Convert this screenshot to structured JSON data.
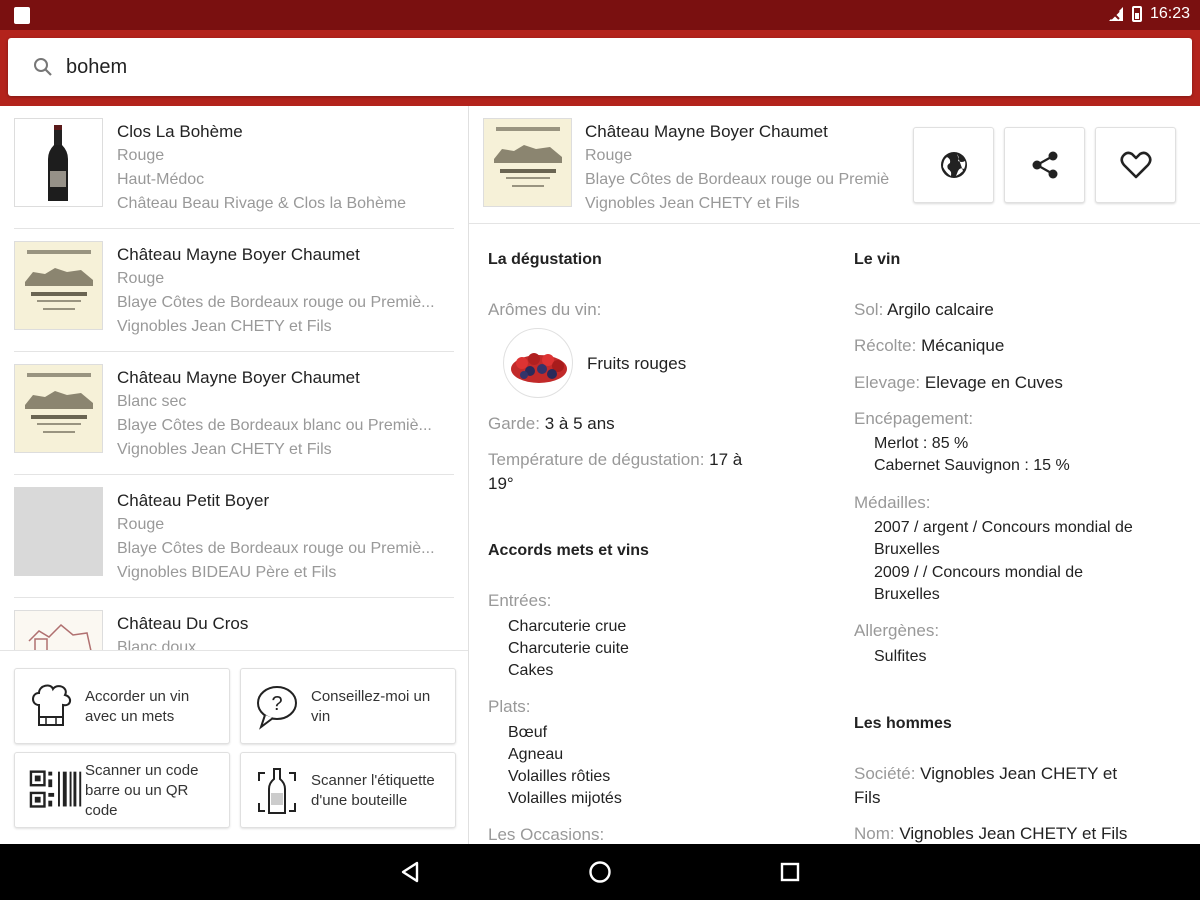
{
  "status_bar": {
    "time": "16:23"
  },
  "search": {
    "value": "bohem"
  },
  "results": [
    {
      "name": "Clos La Bohème",
      "lines": [
        "Rouge",
        "Haut-Médoc",
        "Château Beau Rivage & Clos la Bohème"
      ]
    },
    {
      "name": "Château Mayne Boyer Chaumet",
      "lines": [
        "Rouge",
        "Blaye Côtes de Bordeaux rouge ou Premiè...",
        "Vignobles Jean CHETY et Fils"
      ]
    },
    {
      "name": "Château Mayne Boyer Chaumet",
      "lines": [
        "Blanc sec",
        "Blaye Côtes de Bordeaux blanc ou Premiè...",
        "Vignobles Jean CHETY et Fils"
      ]
    },
    {
      "name": "Château  Petit Boyer",
      "lines": [
        "Rouge",
        "Blaye Côtes de Bordeaux rouge ou Premiè...",
        "Vignobles BIDEAU Père et Fils"
      ]
    },
    {
      "name": "Château Du Cros",
      "lines": [
        "Blanc doux"
      ]
    }
  ],
  "actions": {
    "pair": "Accorder un vin avec un mets",
    "advise": "Conseillez-moi un vin",
    "scan_code": "Scanner un code barre ou un QR code",
    "scan_label": "Scanner l'étiquette d'une bouteille"
  },
  "detail": {
    "name": "Château Mayne Boyer Chaumet",
    "color": "Rouge",
    "appellation": "Blaye Côtes de Bordeaux rouge ou Premiè",
    "producer": "Vignobles Jean CHETY et Fils",
    "tasting": {
      "title": "La dégustation",
      "aromas_label": "Arômes du vin:",
      "aroma": "Fruits rouges",
      "keep_label": "Garde:",
      "keep_value": "3 à 5 ans",
      "temp_label": "Température de dégustation:",
      "temp_value_1": "17 à",
      "temp_value_2": "19°"
    },
    "pairing": {
      "title": "Accords mets et vins",
      "starters_label": "Entrées:",
      "starters": [
        "Charcuterie crue",
        "Charcuterie cuite",
        "Cakes"
      ],
      "mains_label": "Plats:",
      "mains": [
        "Bœuf",
        "Agneau",
        "Volailles rôties",
        "Volailles mijotés"
      ],
      "occasions_label": "Les Occasions:"
    },
    "wine": {
      "title": "Le vin",
      "soil_label": "Sol:",
      "soil": "Argilo calcaire",
      "harvest_label": "Récolte:",
      "harvest": "Mécanique",
      "aging_label": "Elevage:",
      "aging": "Elevage en Cuves",
      "grapes_label": "Encépagement:",
      "grapes": [
        "Merlot : 85 %",
        "Cabernet Sauvignon : 15 %"
      ],
      "medals_label": "Médailles:",
      "medals": [
        "2007 / argent / Concours mondial de",
        "Bruxelles",
        "2009 /  / Concours mondial de",
        "Bruxelles"
      ],
      "allergens_label": "Allergènes:",
      "allergens": [
        "Sulfites"
      ]
    },
    "people": {
      "title": "Les hommes",
      "company_label": "Société:",
      "company_1": "Vignobles Jean CHETY et",
      "company_2": "Fils",
      "name_label": "Nom:",
      "name": "Vignobles Jean CHETY et Fils"
    }
  },
  "colors": {
    "status_bar": "#7a1010",
    "search_bar": "#b3231c"
  }
}
